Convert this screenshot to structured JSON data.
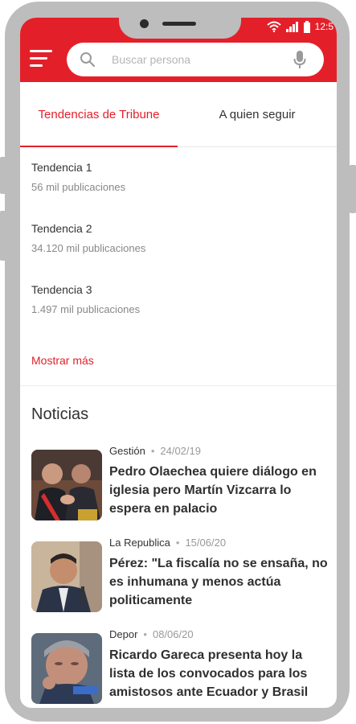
{
  "search": {
    "placeholder": "Buscar persona"
  },
  "status": {
    "time": "12:5"
  },
  "tabs": [
    {
      "label": "Tendencias de Tribune",
      "active": true
    },
    {
      "label": "A quien seguir",
      "active": false
    }
  ],
  "trends": [
    {
      "name": "Tendencia 1",
      "count": "56 mil publicaciones"
    },
    {
      "name": "Tendencia 2",
      "count": "34.120 mil publicaciones"
    },
    {
      "name": "Tendencia 3",
      "count": "1.497 mil publicaciones"
    }
  ],
  "show_more": "Mostrar más",
  "news_section": {
    "title": "Noticias"
  },
  "news": [
    {
      "source": "Gestión",
      "date": "24/02/19",
      "headline": "Pedro Olaechea quiere diálogo en iglesia pero Martín Vizcarra lo espera en palacio"
    },
    {
      "source": "La Republica",
      "date": "15/06/20",
      "headline": "Pérez: \"La fiscalía no se ensaña, no es inhumana y menos actúa politicamente"
    },
    {
      "source": "Depor",
      "date": "08/06/20",
      "headline": "Ricardo Gareca presenta hoy la lista de los convocados para los amistosos ante Ecuador y Brasil"
    }
  ],
  "colors": {
    "brand": "#e3202a",
    "frame": "#bdbdbd"
  },
  "icons": {
    "menu": "hamburger-menu-icon",
    "search": "search-icon",
    "mic": "microphone-icon",
    "wifi": "wifi-icon",
    "signal": "signal-icon",
    "battery": "battery-icon"
  }
}
